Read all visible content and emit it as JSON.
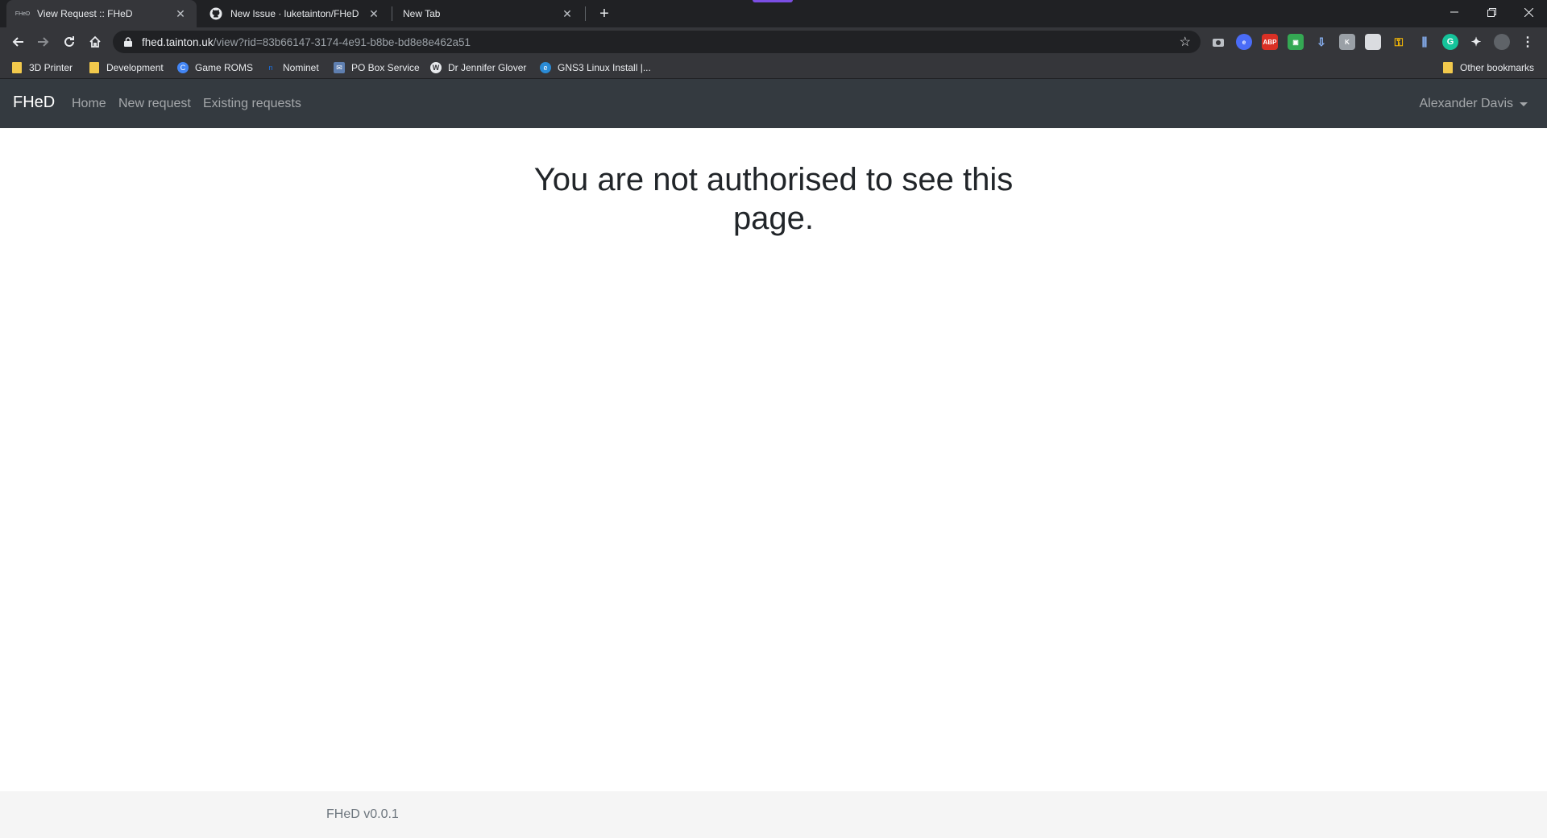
{
  "browser": {
    "tabs": [
      {
        "title": "View Request :: FHeD",
        "favicon": "FHeD"
      },
      {
        "title": "New Issue · luketainton/FHeD"
      },
      {
        "title": "New Tab"
      }
    ],
    "url_host": "fhed.tainton.uk",
    "url_path": "/view?rid=83b66147-3174-4e91-b8be-bd8e8e462a51",
    "bookmarks": [
      {
        "label": "3D Printer",
        "icon": "folder-icon"
      },
      {
        "label": "Development",
        "icon": "folder-icon"
      },
      {
        "label": "Game ROMS",
        "icon": "game-roms-icon"
      },
      {
        "label": "Nominet",
        "icon": "nominet-icon"
      },
      {
        "label": "PO Box Service",
        "icon": "po-box-icon"
      },
      {
        "label": "Dr Jennifer Glover",
        "icon": "wordpress-icon"
      },
      {
        "label": "GNS3 Linux Install |...",
        "icon": "edge-icon"
      }
    ],
    "other_bookmarks": "Other bookmarks",
    "extension_badge": "ABP"
  },
  "app": {
    "brand": "FHeD",
    "nav": {
      "home": "Home",
      "new_request": "New request",
      "existing_requests": "Existing requests"
    },
    "user": "Alexander Davis",
    "message": "You are not authorised to see this page.",
    "footer": "FHeD v0.0.1"
  },
  "colors": {
    "navbar": "#343a40",
    "footer": "#f5f5f5",
    "chrome_dark": "#202124",
    "chrome_toolbar": "#35363a"
  }
}
